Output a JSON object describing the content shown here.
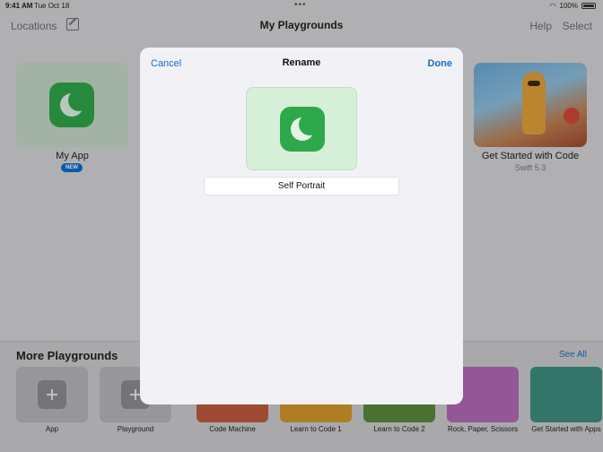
{
  "status_bar": {
    "time": "9:41 AM",
    "date": "Tue Oct 18",
    "battery": "100%"
  },
  "navbar": {
    "locations": "Locations",
    "title": "My Playgrounds",
    "help": "Help",
    "select": "Select"
  },
  "my_playgrounds": [
    {
      "name": "My App",
      "badge": "NEW"
    },
    {
      "name": "Get Started with Code",
      "subtitle": "Swift 5.3"
    }
  ],
  "more_playgrounds": {
    "title": "More Playgrounds",
    "see_all": "See All",
    "items": [
      {
        "label": "App"
      },
      {
        "label": "Playground"
      },
      {
        "label": "Code Machine"
      },
      {
        "label": "Learn to Code 1"
      },
      {
        "label": "Learn to Code 2"
      },
      {
        "label": "Rock, Paper, Scissors"
      },
      {
        "label": "Get Started with Apps"
      }
    ]
  },
  "rename_modal": {
    "cancel": "Cancel",
    "title": "Rename",
    "done": "Done",
    "name_value": "Self Portrait"
  },
  "colors": {
    "accent": "#1a6bc4",
    "app_icon_green": "#2fa84a",
    "badge_blue": "#0a6ed1"
  },
  "icons": [
    "compose-icon",
    "wifi-icon",
    "battery-icon",
    "moon-app-icon",
    "plus-icon"
  ]
}
